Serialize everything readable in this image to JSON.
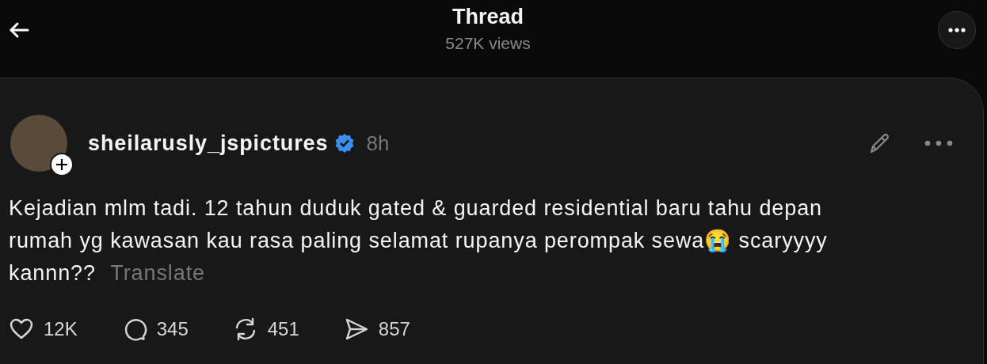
{
  "header": {
    "title": "Thread",
    "views": "527K views"
  },
  "post": {
    "author": "sheilarusly_jspictures",
    "verified": true,
    "time": "8h",
    "text": "Kejadian mlm tadi. 12 tahun duduk gated & guarded residential baru tahu depan rumah yg kawasan kau rasa paling selamat rupanya perompak sewa😭 scaryyyy kannn??",
    "translate": "Translate",
    "actions": [
      {
        "kind": "like",
        "count": "12K"
      },
      {
        "kind": "reply",
        "count": "345"
      },
      {
        "kind": "repost",
        "count": "451"
      },
      {
        "kind": "share",
        "count": "857"
      }
    ]
  }
}
